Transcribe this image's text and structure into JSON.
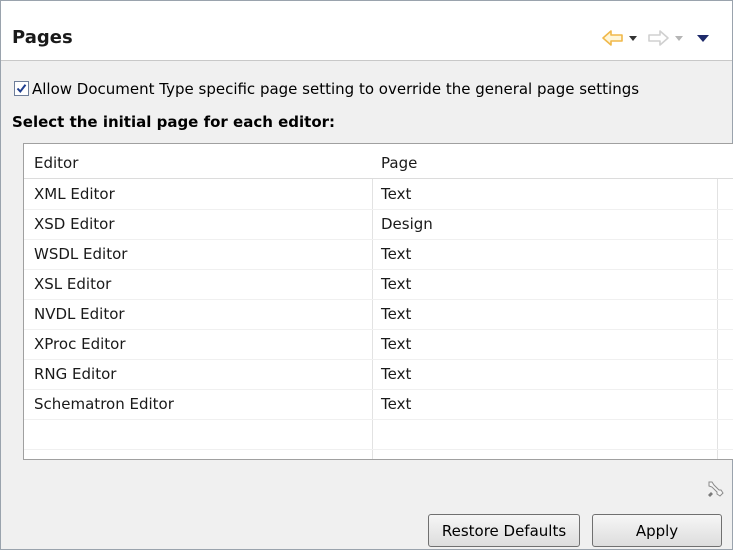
{
  "header": {
    "title": "Pages",
    "nav_icons": [
      "back-arrow-icon",
      "dropdown-icon",
      "forward-arrow-icon",
      "dropdown-icon",
      "view-menu-icon"
    ]
  },
  "settings": {
    "override_checkbox": {
      "checked": true,
      "label": "Allow Document Type specific page setting to override the general page settings"
    },
    "section_label": "Select the initial page for each editor:"
  },
  "table": {
    "columns": [
      "Editor",
      "Page"
    ],
    "rows": [
      {
        "editor": "XML Editor",
        "page": "Text"
      },
      {
        "editor": "XSD Editor",
        "page": "Design"
      },
      {
        "editor": "WSDL Editor",
        "page": "Text"
      },
      {
        "editor": "XSL Editor",
        "page": "Text"
      },
      {
        "editor": "NVDL Editor",
        "page": "Text"
      },
      {
        "editor": "XProc Editor",
        "page": "Text"
      },
      {
        "editor": "RNG Editor",
        "page": "Text"
      },
      {
        "editor": "Schematron Editor",
        "page": "Text"
      }
    ]
  },
  "buttons": {
    "restore_defaults": "Restore Defaults",
    "apply": "Apply"
  },
  "colors": {
    "back_arrow": "#f0b84a",
    "forward_arrow": "#d0d0d0",
    "dropdown": "#333333",
    "view_menu": "#1e2a6a",
    "check_mark": "#1f3e8f"
  }
}
